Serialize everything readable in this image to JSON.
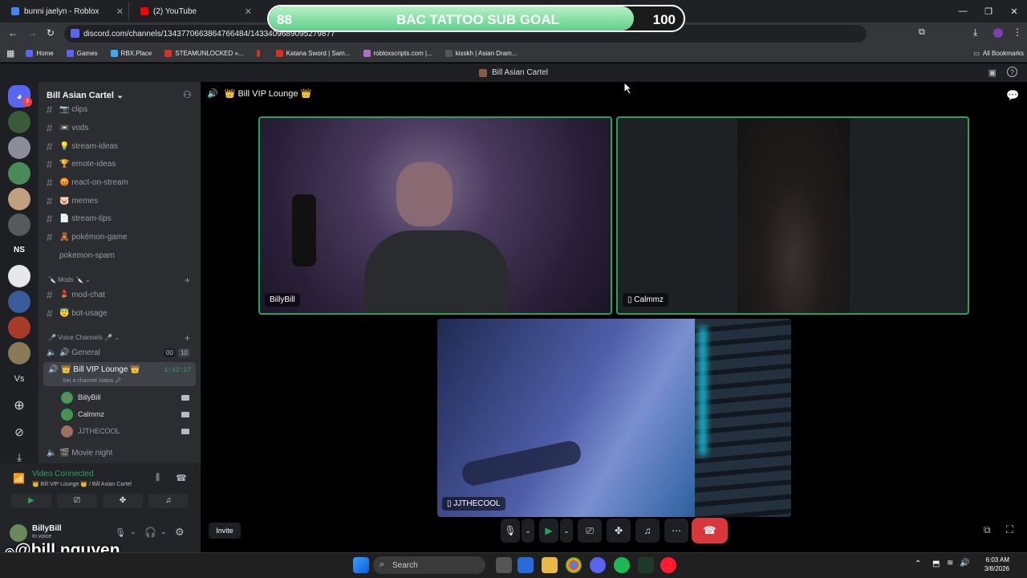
{
  "browser": {
    "tabs": [
      {
        "title": "bunni jaelyn - Roblox",
        "color": "#4285f4"
      },
      {
        "title": "(2) YouTube",
        "color": "#ff0000"
      }
    ],
    "url": "discord.com/channels/1343770663864766484/1433409689095279877",
    "bookmarks": [
      "Home",
      "Games",
      "RBX.Place",
      "STEAMUNLOCKED »...",
      "Katana Sword | Sam...",
      "robloxscripts.com |...",
      "kisskh | Asian Dram..."
    ],
    "all_bookmarks": "All Bookmarks"
  },
  "overlay": {
    "title": "BAC TATTOO SUB GOAL",
    "current": "88",
    "goal": "100",
    "progress": 0.88,
    "handle": "@bill.nguyen"
  },
  "window_title": "Bill Asian Cartel",
  "rail": {
    "badge": "3",
    "ns": "NS",
    "vs": "Vs"
  },
  "server": {
    "name": "Bill Asian Cartel",
    "channels": [
      {
        "label": "📷 clips",
        "type": "text"
      },
      {
        "label": "📼 vods",
        "type": "text"
      },
      {
        "label": "💡 stream-ideas",
        "type": "text"
      },
      {
        "label": "🏆 emote-ideas",
        "type": "text"
      },
      {
        "label": "😡 react-on-stream",
        "type": "text"
      },
      {
        "label": "🐷 memes",
        "type": "text"
      },
      {
        "label": "📄 stream-tips",
        "type": "text"
      },
      {
        "label": "🧸 pokémon-game",
        "type": "text"
      },
      {
        "label": "pokemon-spam",
        "type": "text"
      }
    ],
    "mods_category": "🔪 Mods 🔪",
    "mods_channels": [
      "💄 mod-chat",
      "😇 bot-usage"
    ],
    "voice_category": "🎤 Voice Channels 🎤",
    "general": {
      "label": "🔊 General",
      "count_a": "00",
      "count_b": "10"
    },
    "vip": {
      "label": "👑 Bill VIP Lounge 👑",
      "timer": "1:42:27",
      "status": "Set a channel status 🖉"
    },
    "members": [
      "BillyBill",
      "Calmmz",
      "JJTHECOOL"
    ],
    "movie": "🎬 Movie night"
  },
  "voice_panel": {
    "status": "Video Connected",
    "location": "👑 Bill VIP Lounge 👑 / Bill Asian Cartel",
    "user": "BillyBill",
    "user_status": "In voice"
  },
  "stage": {
    "header": "👑 Bill VIP Lounge 👑",
    "tiles": [
      "BillyBill",
      "Calmmz",
      "JJTHECOOL"
    ],
    "invite": "Invite"
  },
  "taskbar": {
    "search": "Search",
    "time": "6:03 AM",
    "date": "3/8/2026"
  }
}
